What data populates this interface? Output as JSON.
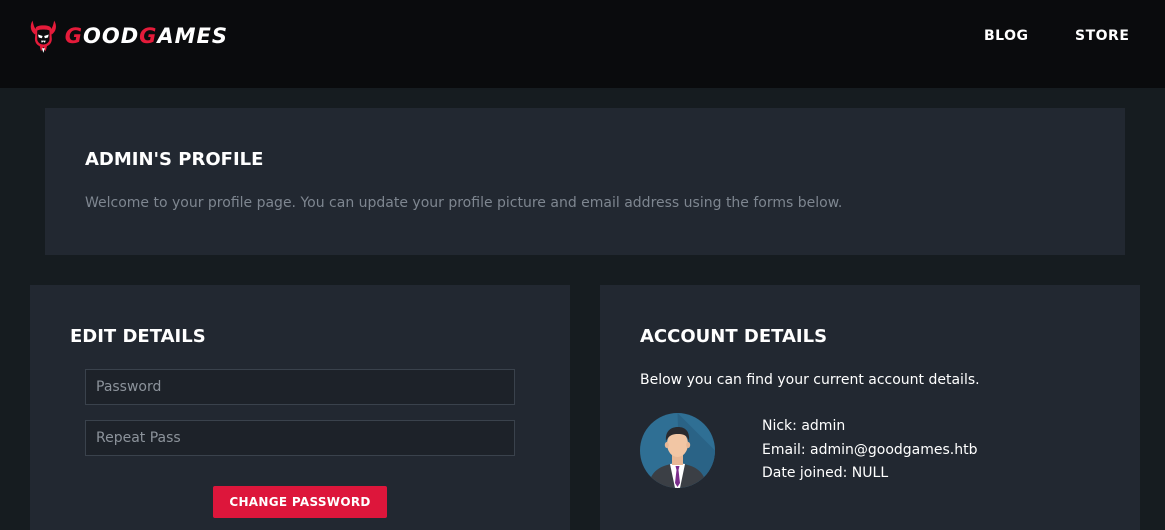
{
  "navbar": {
    "logo": {
      "text_red_1": "G",
      "text_white_1": "OOD",
      "text_red_2": "G",
      "text_white_2": "AMES"
    },
    "links": {
      "blog": "BLOG",
      "store": "STORE"
    }
  },
  "profile": {
    "title": "ADMIN'S PROFILE",
    "description": "Welcome to your profile page. You can update your profile picture and email address using the forms below."
  },
  "edit_details": {
    "title": "EDIT DETAILS",
    "password_placeholder": "Password",
    "password_value": "",
    "repeat_placeholder": "Repeat Pass",
    "repeat_value": "",
    "button_label": "CHANGE PASSWORD"
  },
  "account_details": {
    "title": "ACCOUNT DETAILS",
    "intro": "Below you can find your current account details.",
    "nick": "Nick: admin",
    "email": "Email: admin@goodgames.htb",
    "date_joined": "Date joined: NULL"
  },
  "colors": {
    "accent": "#dd163b",
    "navbar_bg": "#0a0b0d",
    "page_bg": "#161c20",
    "panel_bg": "#222831"
  },
  "icons": {
    "logo": "demon-skull-logo-icon",
    "avatar": "user-avatar-icon"
  }
}
